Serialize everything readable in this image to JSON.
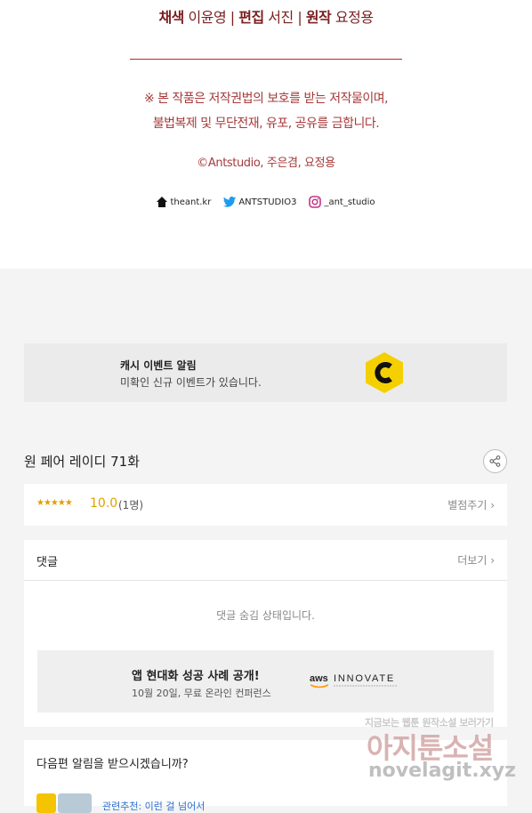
{
  "credits": {
    "coloring_label": "채색",
    "coloring_name": "이윤영",
    "editing_label": "편집",
    "editing_name": "서진",
    "original_label": "원작",
    "original_name": "요정용",
    "separator": "|",
    "notice_line1": "※ 본 작품은 저작권법의 보호를 받는 저작물이며,",
    "notice_line2": "불법복제 및 무단전재, 유포, 공유를 금합니다.",
    "copyright": "©Antstudio, 주은겸, 요정용",
    "socials": [
      {
        "icon": "home-icon",
        "label": "theant.kr"
      },
      {
        "icon": "twitter-icon",
        "label": "ANTSTUDIO3"
      },
      {
        "icon": "instagram-icon",
        "label": "_ant_studio"
      }
    ]
  },
  "event_banner": {
    "title": "캐시 이벤트 알림",
    "subtitle": "미확인 신규 이벤트가 있습니다.",
    "logo_letter": "C",
    "logo_color": "#f5d000"
  },
  "episode": {
    "title": "원 페어 레이디 71화"
  },
  "rating": {
    "stars": "★★★★★",
    "score": "10.0",
    "count": "(1명)",
    "action": "별점주기 ›"
  },
  "comments": {
    "header": "댓글",
    "more": "더보기 ›",
    "hidden_message": "댓글 숨김 상태입니다."
  },
  "ad": {
    "title": "앱 현대화 성공 사례 공개!",
    "subtitle": "10월 20일, 무료 온라인 컨퍼런스",
    "brand": "aws",
    "brand_word": "INNOVATE"
  },
  "notify": {
    "question": "다음편 알림을 받으시겠습니까?",
    "next_title": "관련추천: 이런 걸 넘어서"
  },
  "watermark": {
    "top": "지금보는 웹툰 원작소설 보러가기",
    "big": "아지툰소설",
    "url": "novelagit.xyz"
  },
  "colors": {
    "accent_red": "#b02a2a",
    "star_gold": "#e0a000"
  }
}
